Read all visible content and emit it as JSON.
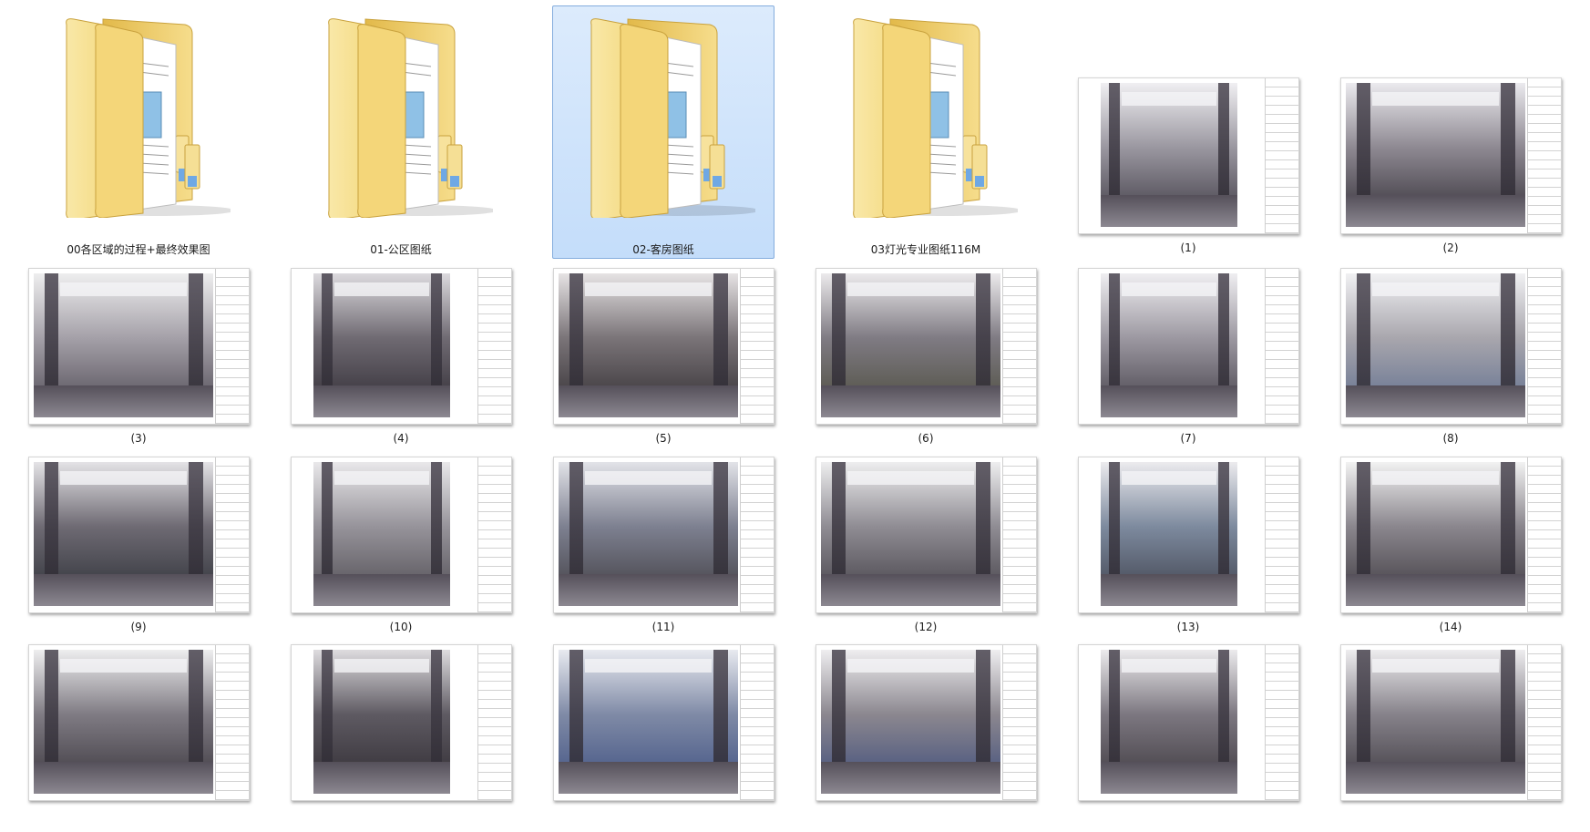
{
  "window": {
    "view_mode": "large-icons"
  },
  "folders": [
    {
      "name": "00各区域的过程+最终效果图",
      "selected": false
    },
    {
      "name": "01-公区图纸",
      "selected": false
    },
    {
      "name": "02-客房图纸",
      "selected": true
    },
    {
      "name": "03灯光专业图纸116M",
      "selected": false
    }
  ],
  "images": [
    {
      "name": "(1)",
      "palette": [
        "#f0eff2",
        "#9a97a0",
        "#3a3640"
      ]
    },
    {
      "name": "(2)",
      "palette": [
        "#ebeaee",
        "#8e8992",
        "#2f2b33"
      ]
    },
    {
      "name": "(3)",
      "palette": [
        "#eeeeef",
        "#a4a0a8",
        "#4b4650"
      ]
    },
    {
      "name": "(4)",
      "palette": [
        "#dcdade",
        "#6f6a72",
        "#2c2830"
      ]
    },
    {
      "name": "(5)",
      "palette": [
        "#e6e3e4",
        "#7a7478",
        "#2e2a2e"
      ]
    },
    {
      "name": "(6)",
      "palette": [
        "#eceaec",
        "#7f7b83",
        "#4a4a3a"
      ]
    },
    {
      "name": "(7)",
      "palette": [
        "#efeef1",
        "#9c98a1",
        "#3f3b44"
      ]
    },
    {
      "name": "(8)",
      "palette": [
        "#f1f1f3",
        "#a8a6ad",
        "#5b6b8c"
      ]
    },
    {
      "name": "(9)",
      "palette": [
        "#e4e3e6",
        "#6e6a73",
        "#2a2e34"
      ]
    },
    {
      "name": "(10)",
      "palette": [
        "#e9e8ea",
        "#96939a",
        "#4b484e"
      ]
    },
    {
      "name": "(11)",
      "palette": [
        "#e2e3e8",
        "#7d8090",
        "#3d3a3e"
      ]
    },
    {
      "name": "(12)",
      "palette": [
        "#eeeeef",
        "#8f8c93",
        "#3e3b42"
      ]
    },
    {
      "name": "(13)",
      "palette": [
        "#ecebee",
        "#7d8a9e",
        "#3b3d48"
      ]
    },
    {
      "name": "(14)",
      "palette": [
        "#f2f2f2",
        "#8a868d",
        "#3a363c"
      ]
    },
    {
      "name": "",
      "palette": [
        "#eeeeef",
        "#7f7b83",
        "#37333a"
      ]
    },
    {
      "name": "",
      "palette": [
        "#dedcdf",
        "#5e5a62",
        "#2e2a30"
      ]
    },
    {
      "name": "",
      "palette": [
        "#e8eaf0",
        "#7f8aa6",
        "#3d4f80"
      ]
    },
    {
      "name": "",
      "palette": [
        "#efeef0",
        "#8b878f",
        "#3b4a7a"
      ]
    },
    {
      "name": "",
      "palette": [
        "#ecebed",
        "#7c7780",
        "#3a363b"
      ]
    },
    {
      "name": "",
      "palette": [
        "#eeedef",
        "#86828a",
        "#39353c"
      ]
    }
  ],
  "colors": {
    "selection_fill": "#cfe3fb",
    "selection_border": "#84acdd",
    "folder_front": "#f3d77a",
    "folder_back": "#e2b94a"
  }
}
